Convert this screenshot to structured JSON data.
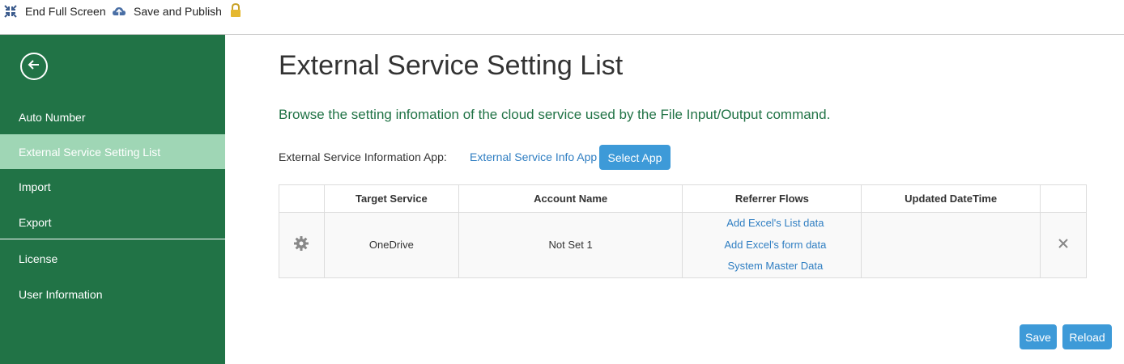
{
  "toolbar": {
    "end_fullscreen_label": "End Full Screen",
    "save_publish_label": "Save and Publish",
    "icons": [
      "collapse-arrows-icon",
      "cloud-upload-icon",
      "lock-icon"
    ]
  },
  "sidebar": {
    "background": "#217346",
    "active_background": "#9fd6b5",
    "items": [
      {
        "label": "Auto Number"
      },
      {
        "label": "External Service Setting List"
      },
      {
        "label": "Import"
      },
      {
        "label": "Export"
      },
      {
        "label": "License"
      },
      {
        "label": "User Information"
      }
    ]
  },
  "main": {
    "title": "External Service Setting List",
    "description": "Browse the setting infomation of the cloud service used by the File Input/Output command.",
    "app_label": "External Service Information App:",
    "app_link": "External Service Info App",
    "select_app_label": "Select App",
    "table": {
      "headers": [
        "",
        "Target Service",
        "Account Name",
        "Referrer Flows",
        "Updated DateTime",
        ""
      ],
      "rows": [
        {
          "target_service": "OneDrive",
          "account_name": "Not Set 1",
          "referrer_flows": [
            "Add Excel's List data",
            "Add Excel's form data",
            "System Master Data"
          ],
          "updated": ""
        }
      ]
    },
    "save_label": "Save",
    "reload_label": "Reload",
    "accent_color": "#3d9ad8",
    "link_color": "#2f7ec2"
  }
}
